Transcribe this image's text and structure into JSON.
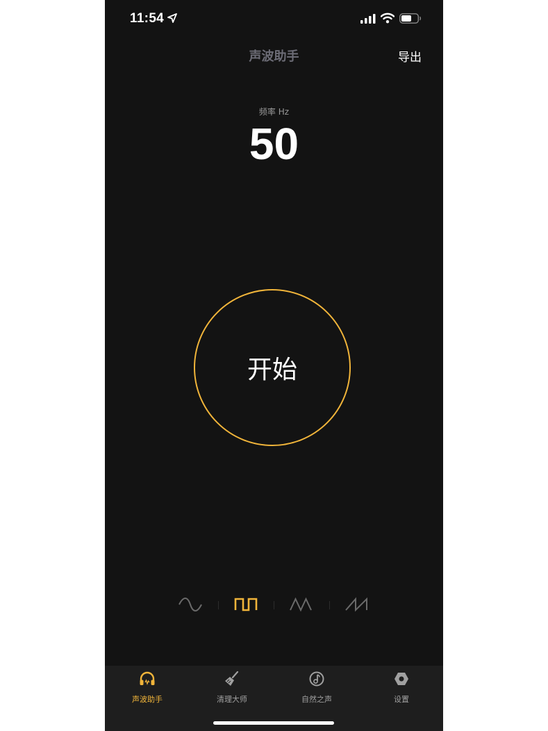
{
  "status_bar": {
    "time": "11:54"
  },
  "nav": {
    "title": "声波助手",
    "export_label": "导出"
  },
  "frequency": {
    "label": "频率 Hz",
    "value": "50"
  },
  "start_button": {
    "label": "开始"
  },
  "waveforms": [
    {
      "name": "sine-wave-icon",
      "selected": false
    },
    {
      "name": "square-wave-icon",
      "selected": true
    },
    {
      "name": "triangle-wave-icon",
      "selected": false
    },
    {
      "name": "sawtooth-wave-icon",
      "selected": false
    }
  ],
  "tabs": [
    {
      "label": "声波助手",
      "icon": "headphones-icon",
      "active": true
    },
    {
      "label": "清理大师",
      "icon": "broom-icon",
      "active": false
    },
    {
      "label": "自然之声",
      "icon": "music-note-icon",
      "active": false
    },
    {
      "label": "设置",
      "icon": "gear-icon",
      "active": false
    }
  ],
  "colors": {
    "accent": "#f0b43a",
    "background": "#131313",
    "tabbar": "#1e1e1e"
  }
}
